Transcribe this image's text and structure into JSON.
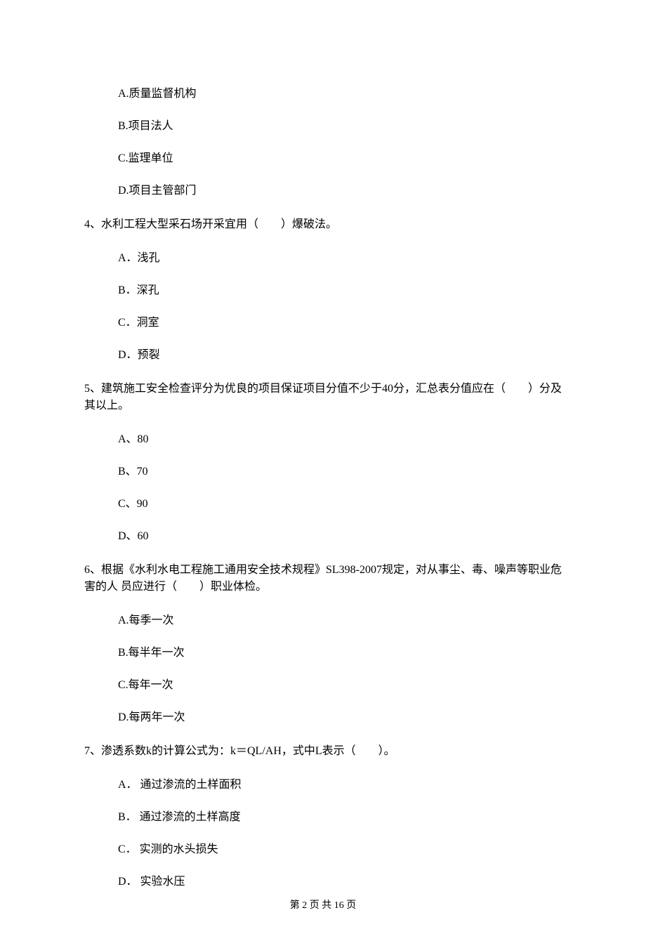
{
  "q3": {
    "options": {
      "a": "A.质量监督机构",
      "b": "B.项目法人",
      "c": "C.监理单位",
      "d": "D.项目主管部门"
    }
  },
  "q4": {
    "text": "4、水利工程大型采石场开采宜用（　　）爆破法。",
    "options": {
      "a": "A．浅孔",
      "b": "B．深孔",
      "c": "C．洞室",
      "d": "D．预裂"
    }
  },
  "q5": {
    "text": "5、建筑施工安全检查评分为优良的项目保证项目分值不少于40分，汇总表分值应在（　　）分及其以上。",
    "options": {
      "a": "A、80",
      "b": "B、70",
      "c": "C、90",
      "d": "D、60"
    }
  },
  "q6": {
    "text": "6、根据《水利水电工程施工通用安全技术规程》SL398-2007规定，对从事尘、毒、噪声等职业危害的人 员应进行（　　）职业体检。",
    "options": {
      "a": "A.每季一次",
      "b": "B.每半年一次",
      "c": "C.每年一次",
      "d": "D.每两年一次"
    }
  },
  "q7": {
    "text": "7、渗透系数k的计算公式为：k＝QL/AH，式中L表示（　　）。",
    "options": {
      "a": "A． 通过渗流的土样面积",
      "b": "B． 通过渗流的土样高度",
      "c": "C． 实测的水头损失",
      "d": "D． 实验水压"
    }
  },
  "footer": "第 2 页 共 16 页"
}
